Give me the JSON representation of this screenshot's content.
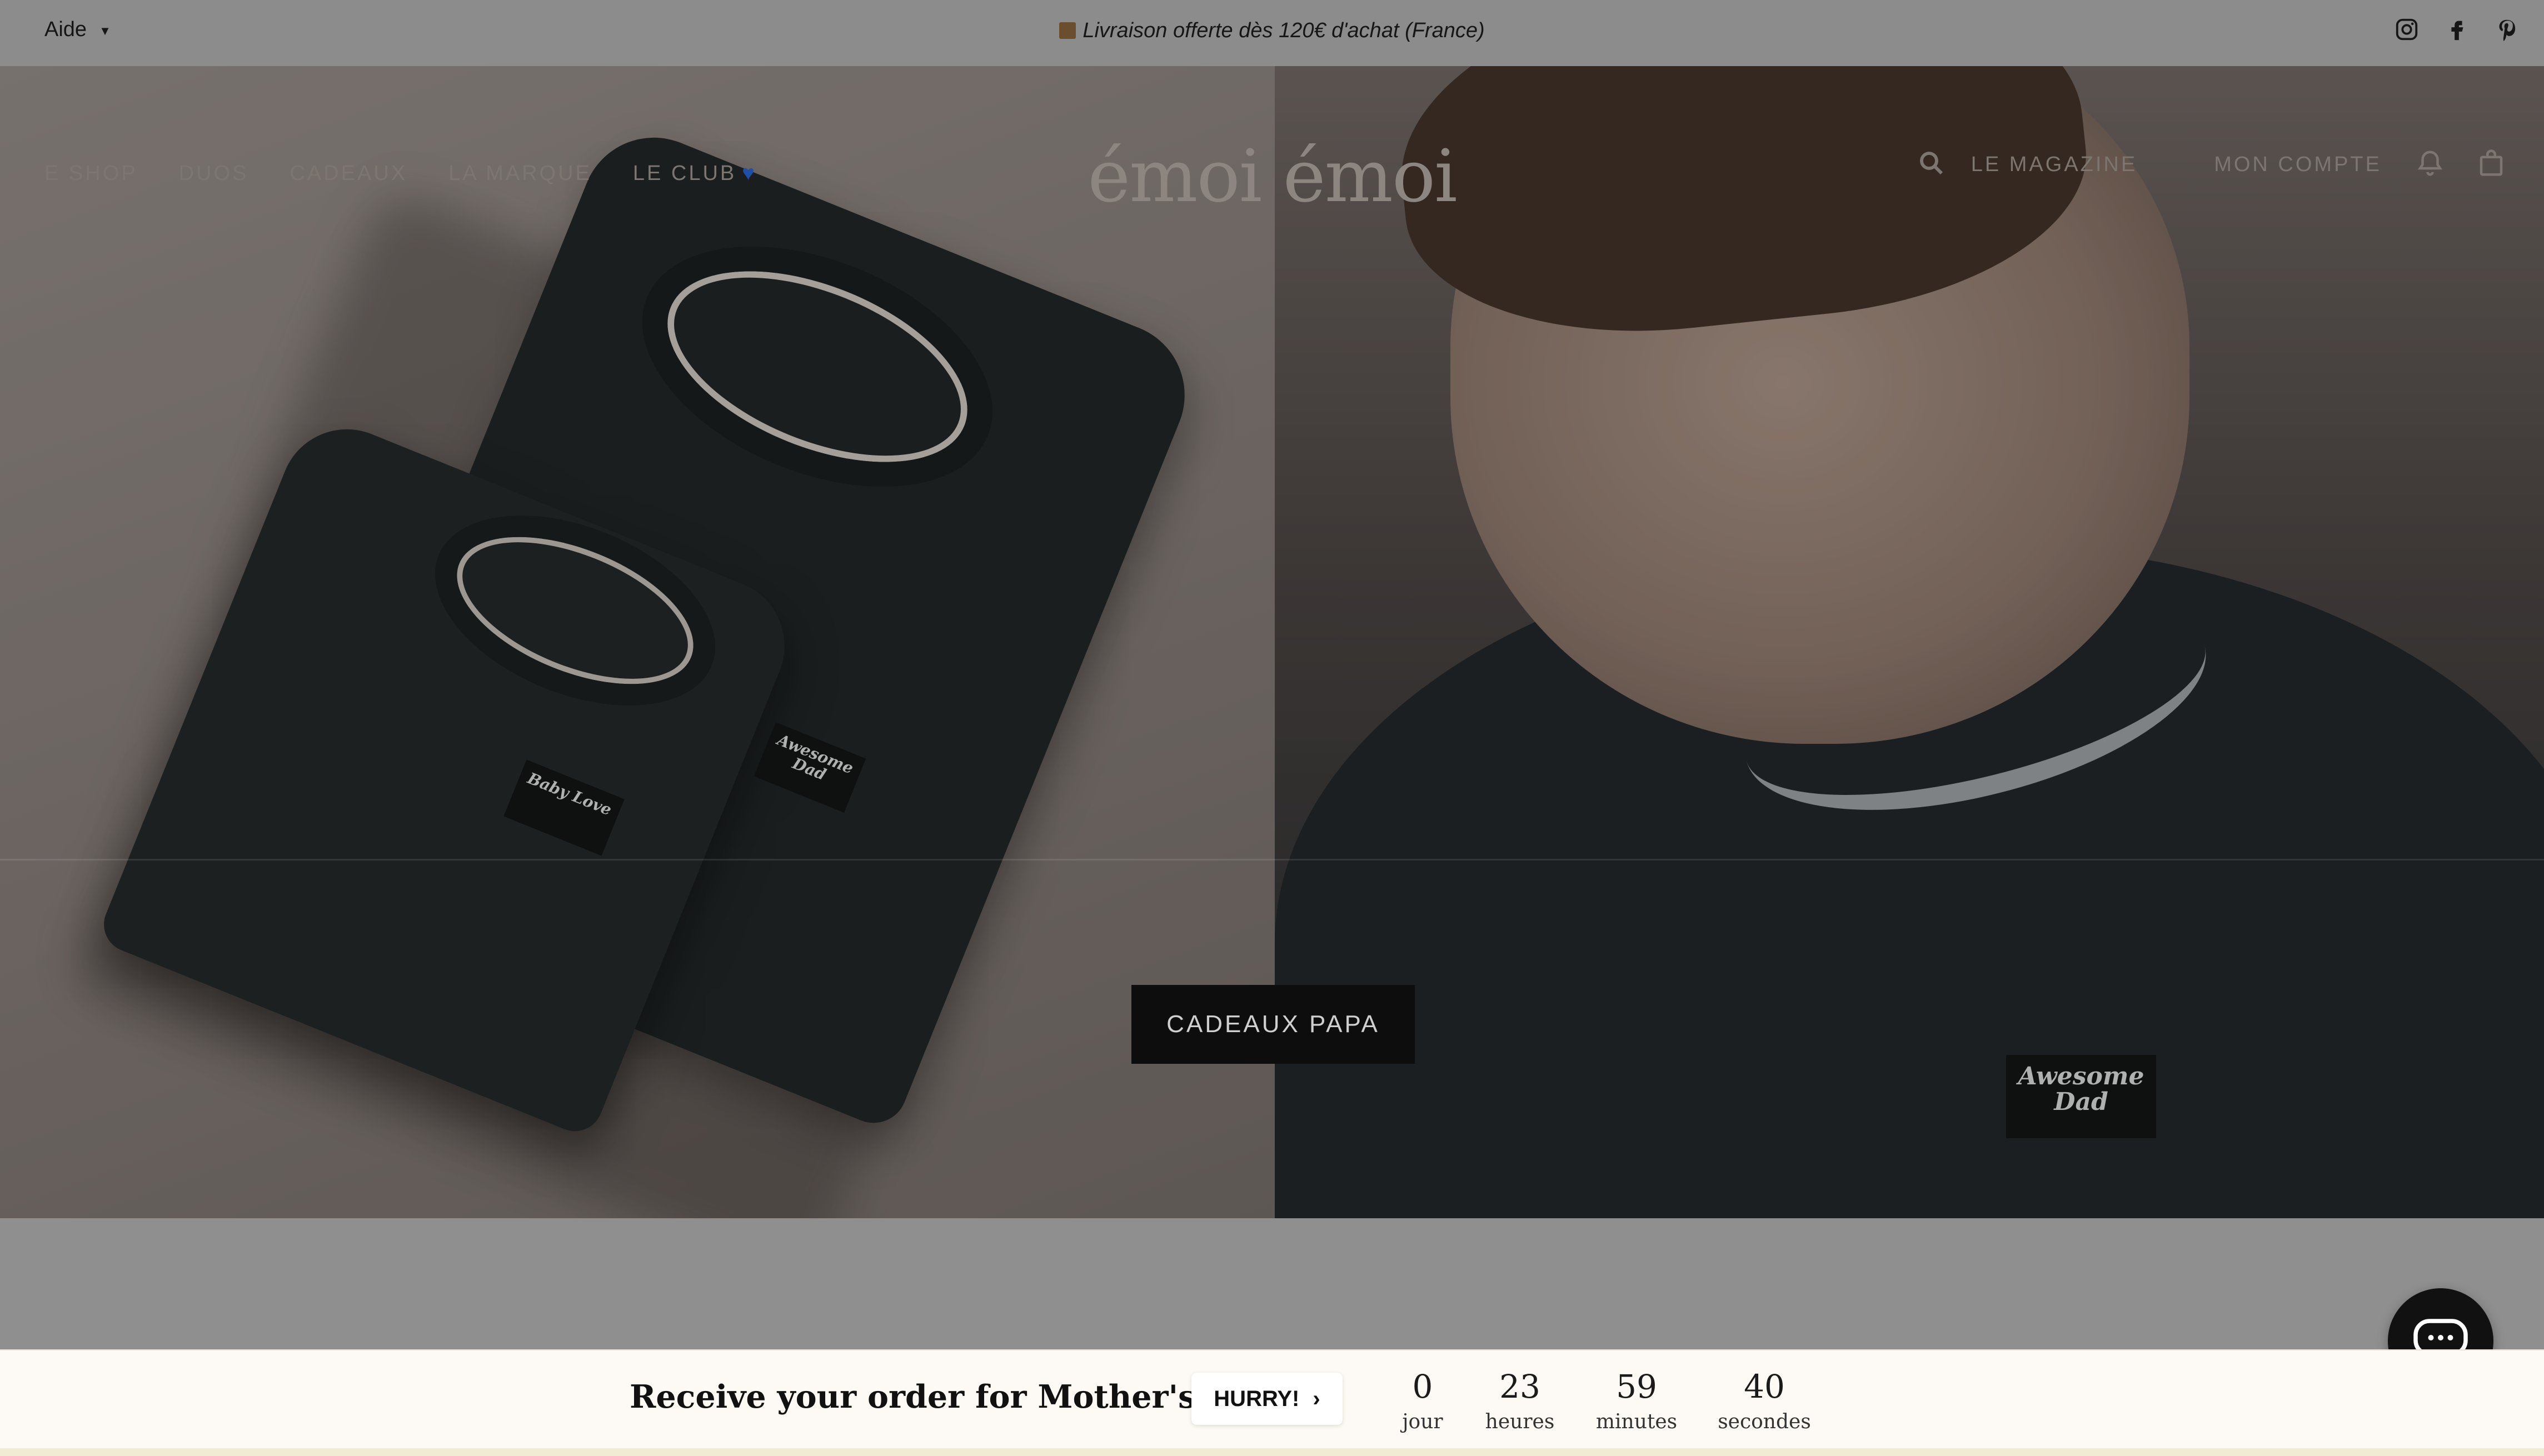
{
  "topbar": {
    "help_label": "Aide",
    "promo_text": "Livraison offerte dès 120€ d'achat (France)"
  },
  "nav": {
    "left": [
      "E SHOP",
      "DUOS",
      "CADEAUX",
      "LA MARQUE",
      "LE CLUB"
    ],
    "logo": "émoi émoi",
    "magazine": "LE MAGAZINE",
    "account": "MON COMPTE"
  },
  "hero": {
    "cta_label": "CADEAUX PAPA",
    "patches": {
      "baby": "Baby Love",
      "dad_small": "Awesome Dad",
      "dad_large": "Awesome Dad"
    }
  },
  "countdown": {
    "title": "Receive your order for Mother's Day",
    "button_label": "HURRY!",
    "units": [
      {
        "value": "0",
        "label": "jour"
      },
      {
        "value": "23",
        "label": "heures"
      },
      {
        "value": "59",
        "label": "minutes"
      },
      {
        "value": "40",
        "label": "secondes"
      }
    ]
  },
  "colors": {
    "cta_bg": "#0d0d0d",
    "banner_bg": "#fdf9f4",
    "heart": "#1f4fa8"
  },
  "icons": [
    "chevron-down-icon",
    "package-icon",
    "instagram-icon",
    "facebook-icon",
    "pinterest-icon",
    "search-icon",
    "bell-icon",
    "bag-icon",
    "chat-icon",
    "chevron-right-icon"
  ]
}
